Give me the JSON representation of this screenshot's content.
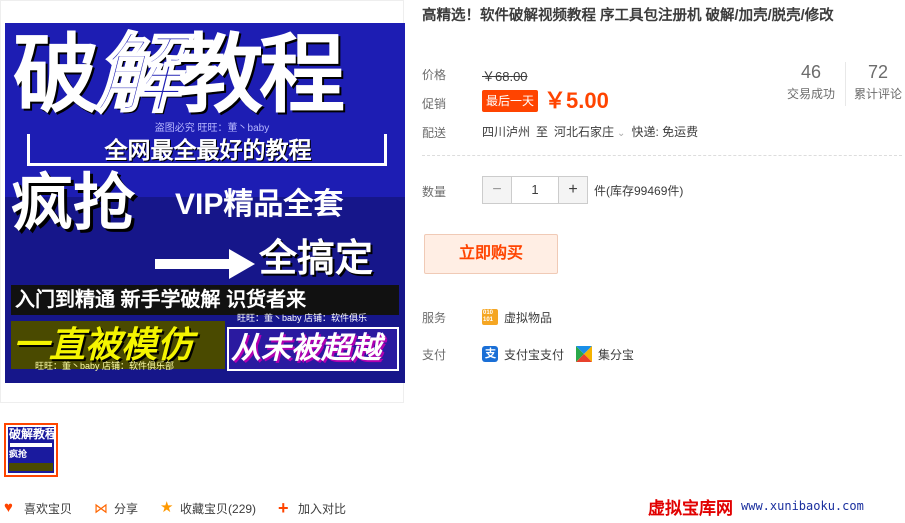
{
  "product": {
    "title": "高精选！软件破解视频教程 序工具包注册机 破解/加壳/脱壳/修改"
  },
  "main_image": {
    "headline_1": "破",
    "headline_2": "解",
    "headline_3": "教程",
    "watermark_top": "盗图必究 旺旺：董丶baby",
    "subtitle": "全网最全最好的教程",
    "rush": "疯抢",
    "vip": "VIP精品全套",
    "all_done": "全搞定",
    "slogan": "入门到精通 新手学破解 识货者来",
    "imitated": "一直被模仿",
    "never_exceeded": "从未被超越",
    "watermark_mid": "旺旺：董丶baby 店铺：软件俱乐",
    "watermark_bottom": "旺旺：董丶baby 店铺：软件俱乐部"
  },
  "thumbnail": {
    "line_1": "破解教程",
    "line_2": "疯抢"
  },
  "labels": {
    "price": "价格",
    "promo": "促销",
    "delivery": "配送",
    "quantity": "数量",
    "service": "服务",
    "payment": "支付"
  },
  "price": {
    "original": "￥68.00",
    "promo_tag": "最后一天",
    "promo_price": "￥5.00"
  },
  "stats": {
    "transactions": "46",
    "transactions_label": "交易成功",
    "reviews": "72",
    "reviews_label": "累计评论"
  },
  "delivery": {
    "from": "四川泸州",
    "to_word": "至",
    "destination": "河北石家庄",
    "express": "快递: 免运费"
  },
  "quantity": {
    "minus": "−",
    "value": "1",
    "plus": "+",
    "stock": "件(库存99469件)"
  },
  "buy_button": "立即购买",
  "service": {
    "icon_text": "010\n101",
    "label": "虚拟物品"
  },
  "payment": {
    "alipay": "支付宝支付",
    "jifenbao": "集分宝",
    "alipay_glyph": "支"
  },
  "actions": {
    "like": "喜欢宝贝",
    "share": "分享",
    "favorite": "收藏宝贝(229)",
    "compare": "加入对比"
  },
  "brand": {
    "name": "虚拟宝库网",
    "url": "www.xunibaoku.com"
  },
  "colors": {
    "accent": "#ff4400",
    "buy_bg": "#ffeee4",
    "image_blue": "#1a1a9e"
  }
}
